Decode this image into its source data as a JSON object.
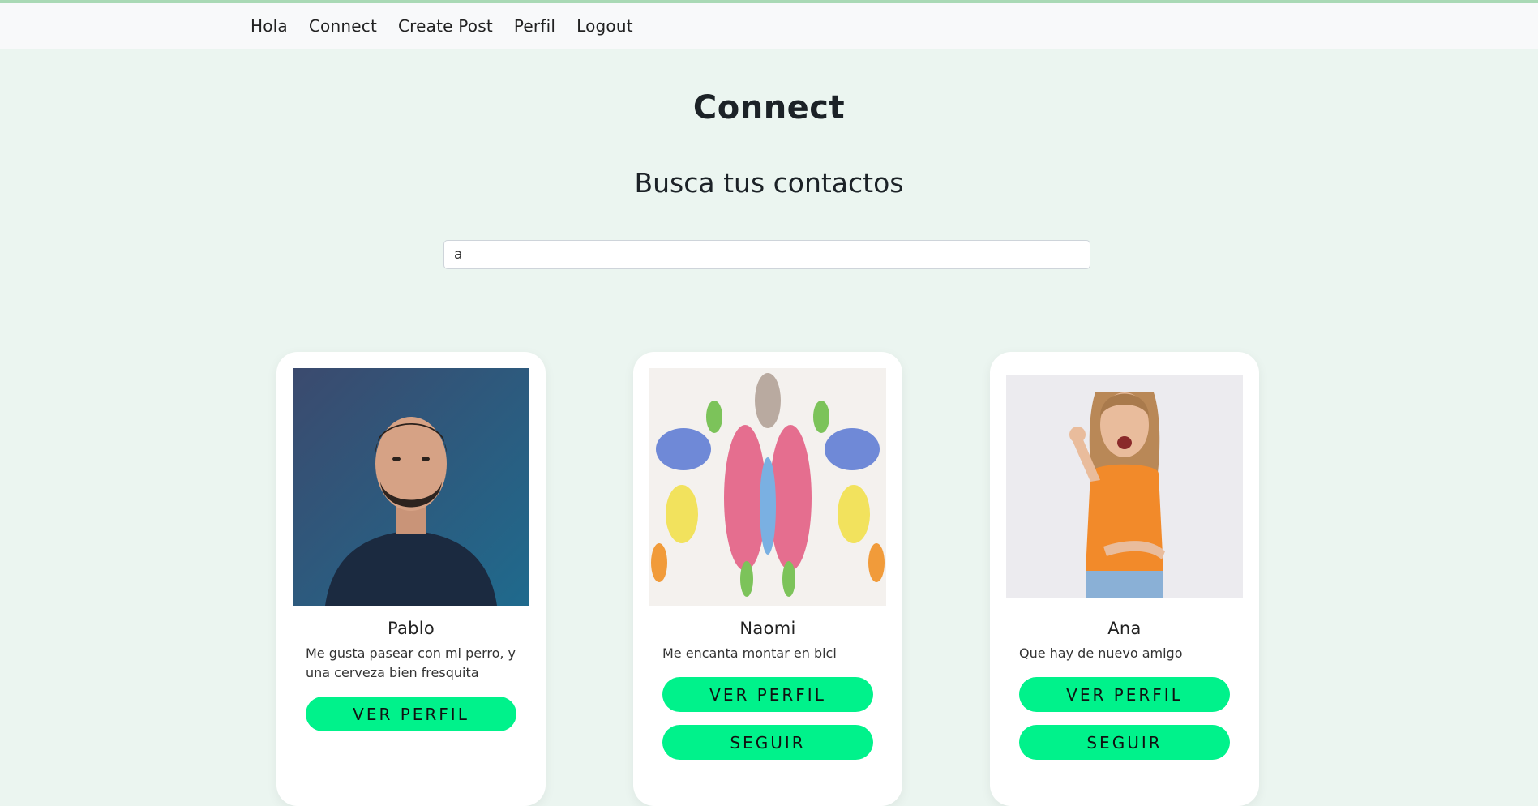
{
  "nav": {
    "items": [
      "Hola",
      "Connect",
      "Create Post",
      "Perfil",
      "Logout"
    ]
  },
  "page": {
    "title": "Connect",
    "subtitle": "Busca tus contactos"
  },
  "search": {
    "value": "a"
  },
  "cards": [
    {
      "name": "Pablo",
      "bio": "Me gusta pasear con mi perro, y una cerveza bien fresquita",
      "view_label": "VER PERFIL",
      "photo_icon": "man-portrait-photo"
    },
    {
      "name": "Naomi",
      "bio": "Me encanta montar en bici",
      "view_label": "VER PERFIL",
      "follow_label": "SEGUIR",
      "photo_icon": "ink-blot-photo"
    },
    {
      "name": "Ana",
      "bio": "Que hay de nuevo amigo",
      "view_label": "VER PERFIL",
      "follow_label": "SEGUIR",
      "photo_icon": "woman-portrait-photo"
    }
  ],
  "colors": {
    "background": "#ebf5f0",
    "navbar": "#f8f9fa",
    "button": "#00f28b",
    "card": "#ffffff"
  }
}
